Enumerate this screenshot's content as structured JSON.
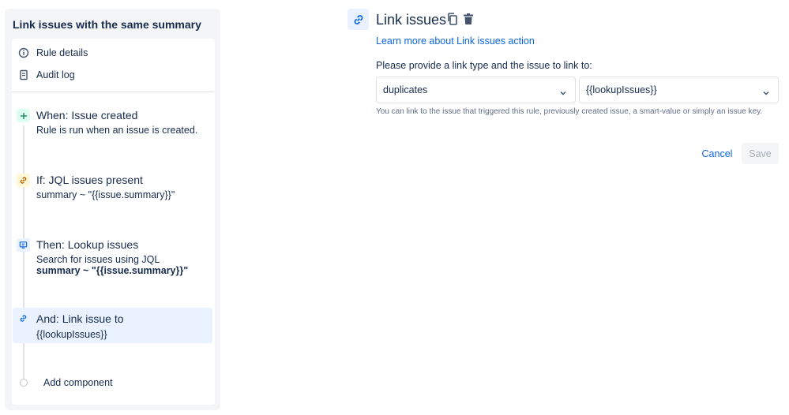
{
  "sidebar": {
    "title": "Link issues with the same summary",
    "nav": {
      "rule_details": "Rule details",
      "audit_log": "Audit log"
    },
    "steps": [
      {
        "title": "When: Issue created",
        "desc": "Rule is run when an issue is created.",
        "icon": "plus-icon",
        "color": "#dcfff1"
      },
      {
        "title": "If: JQL issues present",
        "desc": "summary ~ \"{{issue.summary}}\"",
        "icon": "link-icon",
        "color": "#fff7d6"
      },
      {
        "title": "Then: Lookup issues",
        "desc": "Search for issues using JQL",
        "desc_bold": "summary ~ \"{{issue.summary}}\"",
        "icon": "monitor-icon",
        "color": "#e9f2fe"
      },
      {
        "title": "And: Link issue to",
        "desc": "{{lookupIssues}}",
        "icon": "link-icon",
        "color": "#e9f2fe"
      }
    ],
    "add_component": "Add component"
  },
  "main": {
    "title": "Link issues",
    "learn_more": "Learn more about Link issues action",
    "prompt": "Please provide a link type and the issue to link to:",
    "link_type": {
      "value": "duplicates"
    },
    "issue": {
      "value": "{{lookupIssues}}"
    },
    "helper": "You can link to the issue that triggered this rule, previously created issue, a smart-value or simply an issue key.",
    "cancel_label": "Cancel",
    "save_label": "Save"
  },
  "colors": {
    "accent": "#0c66e4",
    "active_bg": "#e9f2fe",
    "text": "#172b4d",
    "muted": "#626f86"
  }
}
